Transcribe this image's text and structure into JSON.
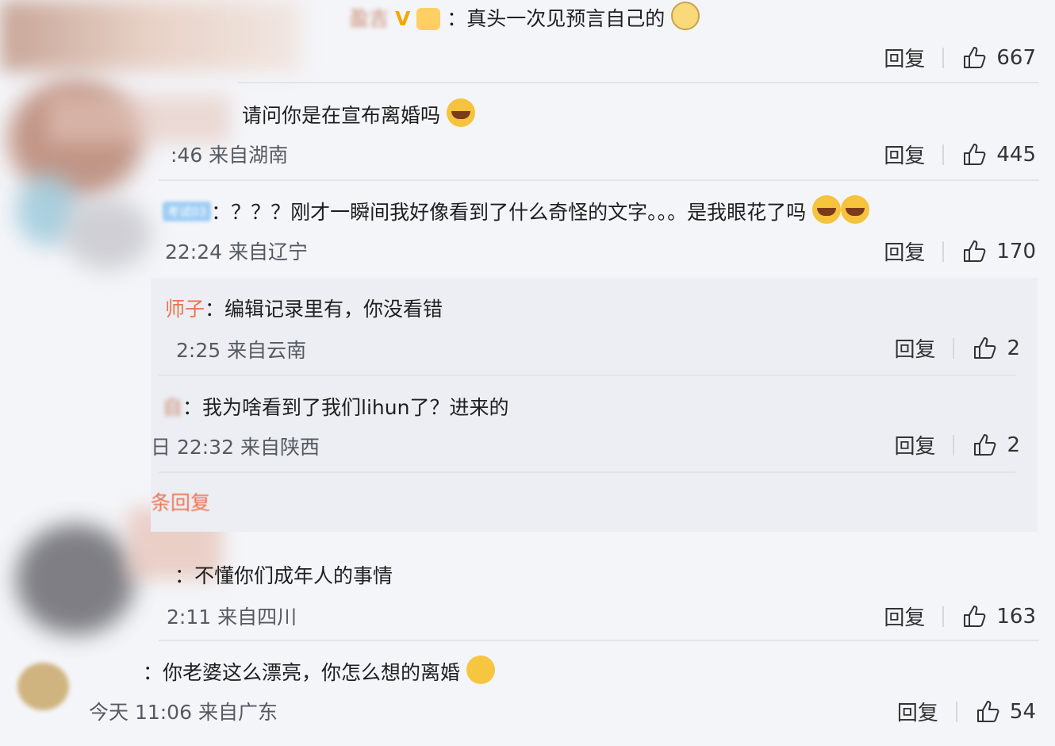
{
  "comments": [
    {
      "text": "：真头一次见预言自己的",
      "meta": "",
      "reply": "回复",
      "likes": "667"
    },
    {
      "text": "请问你是在宣布离婚吗",
      "meta": ":46 来自湖南",
      "reply": "回复",
      "likes": "445"
    },
    {
      "badge": "考试03",
      "text": "：？？？刚才一瞬间我好像看到了什么奇怪的文字。。。是我眼花了吗",
      "meta": "22:24 来自辽宁",
      "reply": "回复",
      "likes": "170"
    },
    {
      "text": "：不懂你们成年人的事情",
      "meta": "2:11 来自四川",
      "reply": "回复",
      "likes": "163"
    },
    {
      "text": "：你老婆这么漂亮，你怎么想的离婚",
      "meta": "今天 11:06 来自广东",
      "reply": "回复",
      "likes": "54"
    }
  ],
  "replies": [
    {
      "name": "师子",
      "text": "：编辑记录里有，你没看错",
      "meta": "2:25 来自云南",
      "reply": "回复",
      "likes": "2"
    },
    {
      "name": "自",
      "text": "：我为啥看到了我们lihun了？进来的",
      "meta": "日 22:32 来自陕西",
      "reply": "回复",
      "likes": "2"
    }
  ],
  "more_replies": "条回复",
  "colors": {
    "accent": "#eb7350",
    "background": "#f4f5f9",
    "panel": "#eceef3"
  }
}
